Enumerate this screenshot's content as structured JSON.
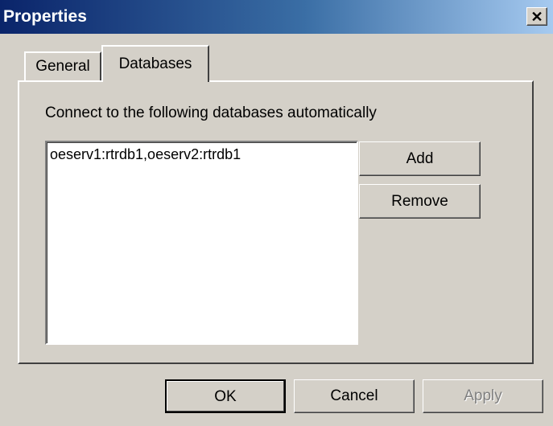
{
  "window": {
    "title": "Properties",
    "close_glyph": "✕",
    "title_gradient": [
      "#0a246a",
      "#a6caf0"
    ]
  },
  "tabs": [
    {
      "label": "General",
      "selected": false
    },
    {
      "label": "Databases",
      "selected": true
    }
  ],
  "databases_tab": {
    "label": "Connect to the following databases automatically",
    "list_items": [
      "oeserv1:rtrdb1,oeserv2:rtrdb1"
    ],
    "add_label": "Add",
    "remove_label": "Remove"
  },
  "footer": {
    "ok_label": "OK",
    "cancel_label": "Cancel",
    "apply_label": "Apply",
    "apply_enabled": false
  }
}
